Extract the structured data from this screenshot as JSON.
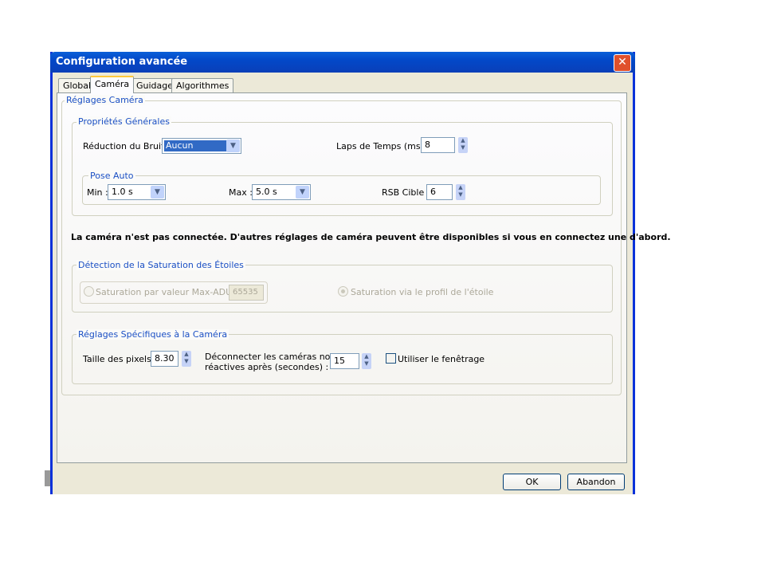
{
  "window": {
    "title": "Configuration avancée"
  },
  "tabs": [
    {
      "label": "Global"
    },
    {
      "label": "Caméra"
    },
    {
      "label": "Guidage"
    },
    {
      "label": "Algorithmes"
    }
  ],
  "camera_settings": {
    "legend": "Réglages Caméra"
  },
  "general": {
    "legend": "Propriétés Générales",
    "noise_label": "Réduction du Bruit :",
    "noise_value": "Aucun",
    "time_lapse_label": "Laps de Temps (ms) :",
    "time_lapse_value": "8"
  },
  "auto_exposure": {
    "legend": "Pose Auto",
    "min_label": "Min :",
    "min_value": "1.0 s",
    "max_label": "Max :",
    "max_value": "5.0 s",
    "snr_label": "RSB Cible :",
    "snr_value": "6"
  },
  "notice": "La caméra n'est pas connectée. D'autres réglages de caméra peuvent être disponibles si vous en connectez une d'abord.",
  "saturation": {
    "legend": "Détection de la Saturation des Étoiles",
    "max_adu_label": "Saturation par valeur Max-ADU :",
    "max_adu_value": "65535",
    "profile_label": "Saturation via le profil de l'étoile",
    "selected": "profile"
  },
  "specific": {
    "legend": "Réglages Spécifiques à la Caméra",
    "pixel_size_label": "Taille des pixels :",
    "pixel_size_value": "8.30",
    "timeout_label_1": "Déconnecter les caméras non",
    "timeout_label_2": "réactives après (secondes) :",
    "timeout_value": "15",
    "windowing_label": "Utiliser le fenêtrage",
    "windowing_checked": false
  },
  "buttons": {
    "ok": "OK",
    "cancel": "Abandon"
  }
}
